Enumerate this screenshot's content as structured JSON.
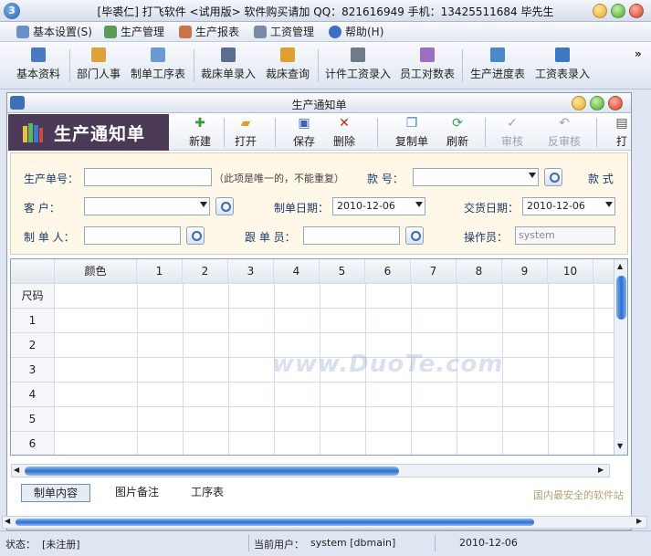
{
  "window": {
    "title": "[毕裘仁] 打飞软件 <试用版> 软件购买请加 QQ：821616949 手机：13425511684 毕先生"
  },
  "menu": {
    "items": [
      {
        "label": "基本设置(S)",
        "icon": "settings-icon"
      },
      {
        "label": "生产管理",
        "icon": "factory-icon"
      },
      {
        "label": "生产报表",
        "icon": "report-icon"
      },
      {
        "label": "工资管理",
        "icon": "salary-icon"
      },
      {
        "label": "帮助(H)",
        "icon": "help-icon"
      }
    ]
  },
  "toolbar": {
    "items": [
      "基本资料",
      "部门人事",
      "制单工序表",
      "裁床单录入",
      "裁床查询",
      "计件工资录入",
      "员工对数表",
      "生产进度表",
      "工资表录入"
    ],
    "more": "»"
  },
  "inner": {
    "title": "生产通知单"
  },
  "header": {
    "title": "生产通知单"
  },
  "doc_toolbar": {
    "new": "新建",
    "open": "打开",
    "save": "保存",
    "delete": "删除",
    "copy": "复制单",
    "refresh": "刷新",
    "audit": "审核",
    "unaudit": "反审核",
    "print": "打"
  },
  "form": {
    "order_no_label": "生产单号：",
    "order_no_value": "",
    "order_no_hint": "（此项是唯一的，不能重复）",
    "style_no_label": "款  号：",
    "style_no_value": "",
    "style_label": "款  式",
    "customer_label": "客    户：",
    "customer_value": "",
    "order_date_label": "制单日期：",
    "order_date_value": "2010-12-06",
    "delivery_date_label": "交货日期：",
    "delivery_date_value": "2010-12-06",
    "maker_label": "制 单 人：",
    "maker_value": "",
    "follower_label": "跟 单 员：",
    "follower_value": "",
    "operator_label": "操作员：",
    "operator_value": "system"
  },
  "grid": {
    "header_corner": "",
    "color_header": "颜色",
    "size_columns": [
      "1",
      "2",
      "3",
      "4",
      "5",
      "6",
      "7",
      "8",
      "9",
      "10"
    ],
    "size_row_label": "尺码",
    "rows": [
      "1",
      "2",
      "3",
      "4",
      "5",
      "6"
    ]
  },
  "tabs": {
    "items": [
      "制单内容",
      "图片备注",
      "工序表"
    ],
    "active": 0
  },
  "status": {
    "state_label": "状态：",
    "state_value": "[未注册]",
    "user_label": "当前用户：",
    "user_value": "system [dbmain]",
    "date": "2010-12-06"
  },
  "watermark": {
    "text": "www.DuoTe.com",
    "corner": "国内最安全的软件站"
  },
  "colors": {
    "header_block": "#4a3a55",
    "form_bg": "#fff8e8",
    "accent": "#2f6fd0"
  }
}
